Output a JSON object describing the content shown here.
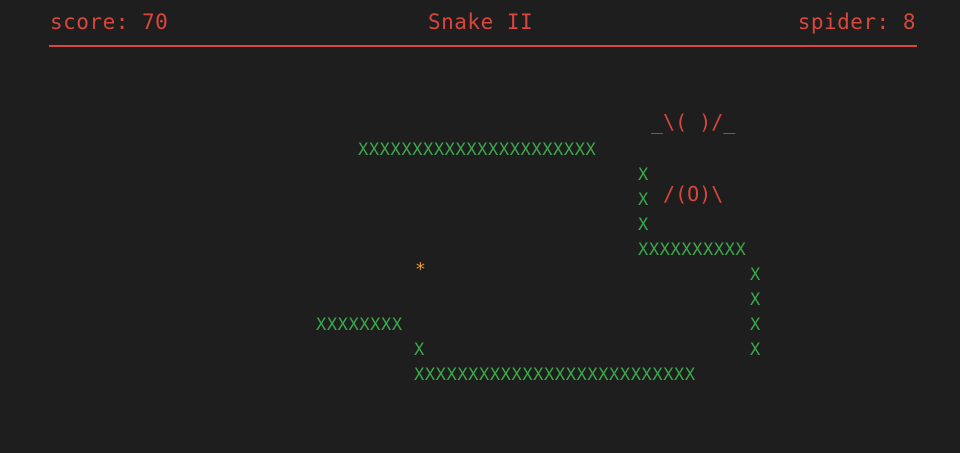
{
  "hud": {
    "score_text": "score: 70",
    "title": "Snake II",
    "spider_text": "spider: 8"
  },
  "spider": {
    "line1": "_\\( )/_",
    "line2": " /(O)\\"
  },
  "food": {
    "glyph": "*"
  },
  "snake": {
    "segments": {
      "top_row": "XXXXXXXXXXXXXXXXXXXXXX",
      "x1": "X",
      "x2": "X",
      "x3": "X",
      "mid_row": "XXXXXXXXXX",
      "r1": "X",
      "r2": "X",
      "r3": "X",
      "r4": "X",
      "left_row": "XXXXXXXX",
      "left_down": "X",
      "bottom_row": "XXXXXXXXXXXXXXXXXXXXXXXXXX"
    }
  },
  "colors": {
    "background": "#1e1e1e",
    "hud": "#d9463c",
    "snake": "#3aa84b",
    "food": "#e79a2c"
  }
}
